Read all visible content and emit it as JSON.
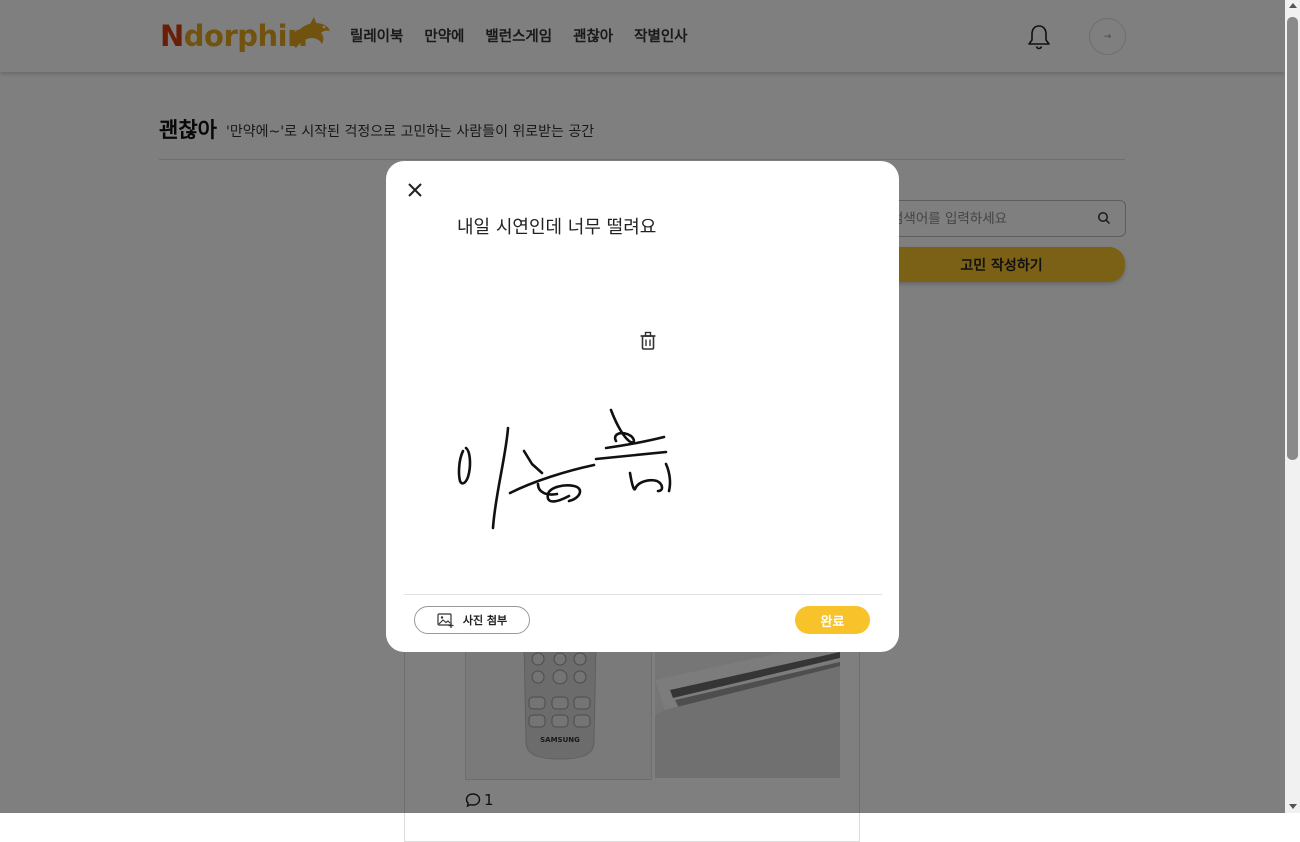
{
  "header": {
    "logo_cap": "N",
    "logo_rest": "dorphin",
    "nav": [
      "릴레이북",
      "만약에",
      "밸런스게임",
      "괜찮아",
      "작별인사"
    ],
    "avatar_text": "→"
  },
  "page": {
    "title": "괜찮아",
    "subtitle": "'만약에~'로 시작된 걱정으로 고민하는 사람들이 위로받는 공간",
    "search_placeholder": "검색어를 입력하세요",
    "write_button": "고민 작성하기",
    "comment_count": "1",
    "photo_brand": "SAMSUNG"
  },
  "modal": {
    "author_avatar_alt": "사진",
    "title": "내일 시연인데 너무 떨려요",
    "attach_label": "사진 첨부",
    "done_label": "완료"
  },
  "colors": {
    "accent": "#f7c22a",
    "logo_cap": "#d33d0f",
    "logo_rest": "#e2a51c",
    "overlay": "rgba(0,0,0,0.5)"
  },
  "icons": [
    "dolphin-icon",
    "bell-icon",
    "search-icon",
    "close-icon",
    "trash-icon",
    "image-add-icon",
    "comment-icon"
  ]
}
